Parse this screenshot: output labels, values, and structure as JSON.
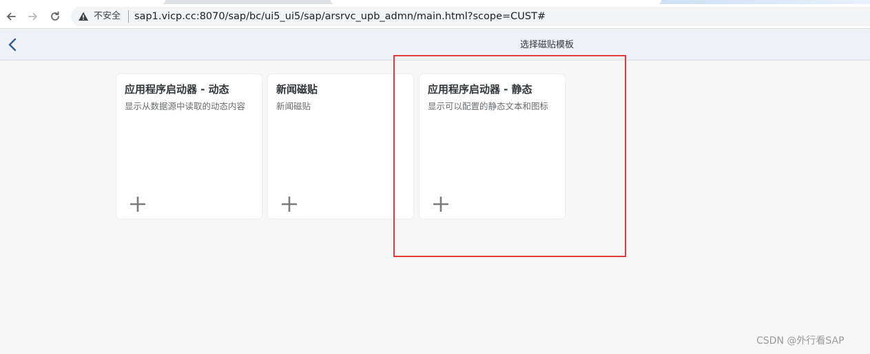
{
  "browser": {
    "security_label": "不安全",
    "url": "sap1.vicp.cc:8070/sap/bc/ui5_ui5/sap/arsrvc_upb_admn/main.html?scope=CUST#"
  },
  "header": {
    "title": "选择磁贴模板"
  },
  "tiles": [
    {
      "title": "应用程序启动器 - 动态",
      "subtitle": "显示从数据源中读取的动态内容"
    },
    {
      "title": "新闻磁贴",
      "subtitle": "新闻磁贴"
    },
    {
      "title": "应用程序启动器 - 静态",
      "subtitle": "显示可以配置的静态文本和图标"
    }
  ],
  "watermark": "CSDN @外行看SAP",
  "colors": {
    "highlight": "#e23b3b",
    "header_bg": "#eef2f6",
    "back_arrow": "#2e5f8a"
  },
  "icons": [
    "back-arrow-icon",
    "forward-arrow-icon",
    "reload-icon",
    "warning-icon",
    "chevron-left-icon",
    "plus-icon"
  ]
}
